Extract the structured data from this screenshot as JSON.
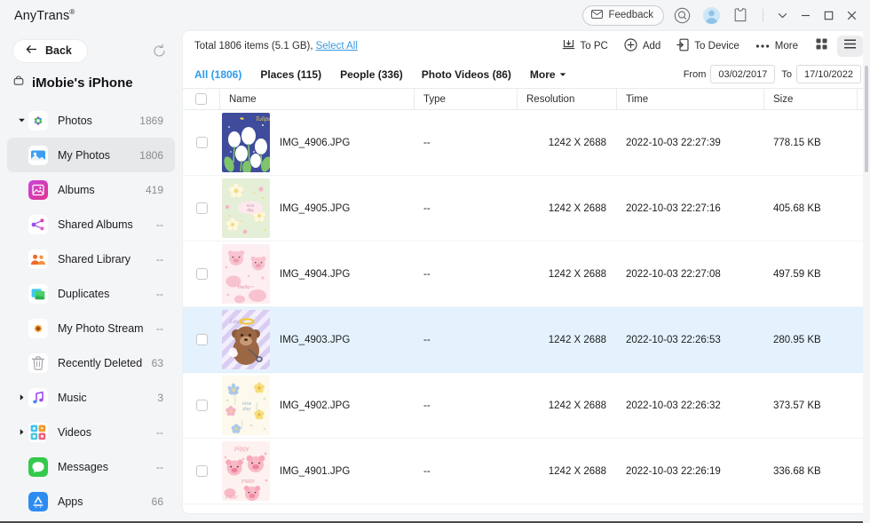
{
  "titlebar": {
    "app_title": "AnyTrans",
    "app_title_sup": "®",
    "feedback_label": "Feedback",
    "icons": {
      "feedback": "envelope-icon",
      "search": "search-icon",
      "account": "avatar-icon",
      "shirt": "shirt-icon",
      "chevron": "chevron-down-icon",
      "minimize": "minimize-icon",
      "maximize": "maximize-icon",
      "close": "close-icon"
    }
  },
  "sidebar": {
    "back_label": "Back",
    "device_name": "iMobie's iPhone",
    "items": [
      {
        "label": "Photos",
        "count": "1869",
        "level": "root",
        "arrow": "down",
        "icon": "photos-icon",
        "selected": false
      },
      {
        "label": "My Photos",
        "count": "1806",
        "level": "child",
        "arrow": "none",
        "icon": "my-photos-icon",
        "selected": true
      },
      {
        "label": "Albums",
        "count": "419",
        "level": "child",
        "arrow": "none",
        "icon": "albums-icon",
        "selected": false
      },
      {
        "label": "Shared Albums",
        "count": "--",
        "level": "child",
        "arrow": "none",
        "icon": "shared-albums-icon",
        "selected": false
      },
      {
        "label": "Shared Library",
        "count": "--",
        "level": "child",
        "arrow": "none",
        "icon": "shared-library-icon",
        "selected": false
      },
      {
        "label": "Duplicates",
        "count": "--",
        "level": "child",
        "arrow": "none",
        "icon": "duplicates-icon",
        "selected": false
      },
      {
        "label": "My Photo Stream",
        "count": "--",
        "level": "child",
        "arrow": "none",
        "icon": "photo-stream-icon",
        "selected": false
      },
      {
        "label": "Recently Deleted",
        "count": "63",
        "level": "child",
        "arrow": "none",
        "icon": "trash-icon",
        "selected": false
      },
      {
        "label": "Music",
        "count": "3",
        "level": "root",
        "arrow": "right",
        "icon": "music-icon",
        "selected": false
      },
      {
        "label": "Videos",
        "count": "--",
        "level": "root",
        "arrow": "right",
        "icon": "videos-icon",
        "selected": false
      },
      {
        "label": "Messages",
        "count": "--",
        "level": "noarrow",
        "arrow": "none",
        "icon": "messages-icon",
        "selected": false
      },
      {
        "label": "Apps",
        "count": "66",
        "level": "noarrow",
        "arrow": "none",
        "icon": "apps-icon",
        "selected": false
      }
    ]
  },
  "actionbar": {
    "total_text": "Total 1806 items (5.1 GB),",
    "select_all_label": "Select All",
    "buttons": [
      {
        "label": "To PC",
        "icon": "to-pc-icon"
      },
      {
        "label": "Add",
        "icon": "add-icon"
      },
      {
        "label": "To Device",
        "icon": "to-device-icon"
      },
      {
        "label": "More",
        "icon": "more-dots-icon"
      }
    ],
    "view_grid_icon": "grid-view-icon",
    "view_list_icon": "list-view-icon",
    "active_view": "list"
  },
  "tabbar": {
    "tabs": [
      {
        "label": "All (1806)",
        "active": true
      },
      {
        "label": "Places (115)",
        "active": false
      },
      {
        "label": "People (336)",
        "active": false
      },
      {
        "label": "Photo Videos (86)",
        "active": false
      },
      {
        "label": "More",
        "active": false,
        "caret": true
      }
    ],
    "from_label": "From",
    "from_value": "03/02/2017",
    "to_label": "To",
    "to_value": "17/10/2022"
  },
  "table": {
    "columns": [
      "Name",
      "Type",
      "Resolution",
      "Time",
      "Size"
    ],
    "rows": [
      {
        "name": "IMG_4906.JPG",
        "type": "--",
        "resolution": "1242 X 2688",
        "time": "2022-10-03 22:27:39",
        "size": "778.15 KB",
        "thumb": "tulips",
        "selected": false
      },
      {
        "name": "IMG_4905.JPG",
        "type": "--",
        "resolution": "1242 X 2688",
        "time": "2022-10-03 22:27:16",
        "size": "405.68 KB",
        "thumb": "flowers-green",
        "selected": false
      },
      {
        "name": "IMG_4904.JPG",
        "type": "--",
        "resolution": "1242 X 2688",
        "time": "2022-10-03 22:27:08",
        "size": "497.59 KB",
        "thumb": "pigs-hello",
        "selected": false
      },
      {
        "name": "IMG_4903.JPG",
        "type": "--",
        "resolution": "1242 X 2688",
        "time": "2022-10-03 22:26:53",
        "size": "280.95 KB",
        "thumb": "bear-angel",
        "selected": true
      },
      {
        "name": "IMG_4902.JPG",
        "type": "--",
        "resolution": "1242 X 2688",
        "time": "2022-10-03 22:26:32",
        "size": "373.57 KB",
        "thumb": "flowers-cream",
        "selected": false
      },
      {
        "name": "IMG_4901.JPG",
        "type": "--",
        "resolution": "1242 X 2688",
        "time": "2022-10-03 22:26:19",
        "size": "336.68 KB",
        "thumb": "piggy-pink",
        "selected": false
      }
    ]
  },
  "colors": {
    "accent": "#2f9bec",
    "link": "#3b9ae1",
    "selected_row": "#e4f2fd",
    "sidebar_bg": "#f4f5f7",
    "sidebar_selected": "#e7e8ea"
  }
}
